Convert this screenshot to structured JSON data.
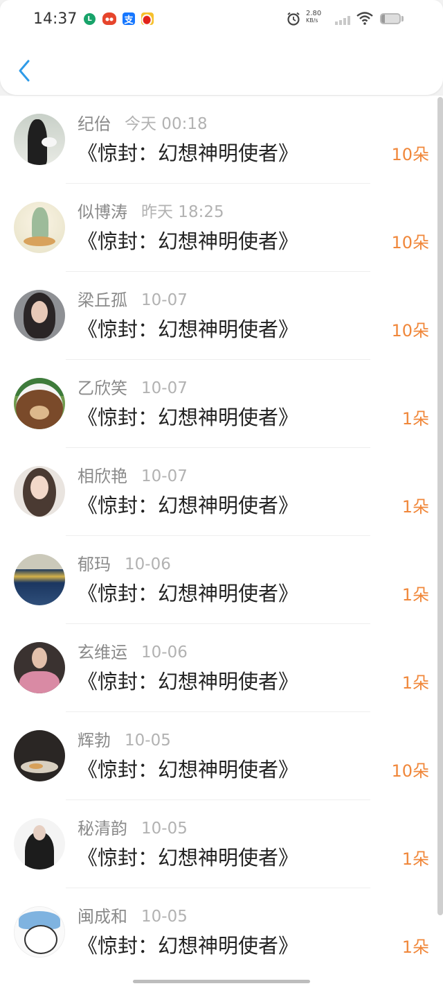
{
  "status_bar": {
    "time": "14:37",
    "l_app_glyph": "L",
    "alipay_glyph": "支",
    "net_speed_value": "2.80",
    "net_speed_unit": "KB/s",
    "battery_level": 0.2,
    "icons": [
      "l-app-icon",
      "red-app-icon",
      "alipay-icon",
      "weibo-icon",
      "alarm-icon",
      "signal-icon",
      "wifi-icon",
      "battery-icon"
    ]
  },
  "header": {
    "back_icon": "chevron-left-icon"
  },
  "colors": {
    "accent": "#2f9be8",
    "count": "#f0873a",
    "name": "#8a8a8a",
    "time": "#b2b2b2",
    "title": "#222222"
  },
  "list": {
    "items": [
      {
        "name": "纪佁",
        "time": "今天 00:18",
        "title": "《惊封：幻想神明使者》",
        "count": "10朵"
      },
      {
        "name": "似博涛",
        "time": "昨天 18:25",
        "title": "《惊封：幻想神明使者》",
        "count": "10朵"
      },
      {
        "name": "梁丘孤",
        "time": "10-07",
        "title": "《惊封：幻想神明使者》",
        "count": "10朵"
      },
      {
        "name": "乙欣笑",
        "time": "10-07",
        "title": "《惊封：幻想神明使者》",
        "count": "1朵"
      },
      {
        "name": "相欣艳",
        "time": "10-07",
        "title": "《惊封：幻想神明使者》",
        "count": "1朵"
      },
      {
        "name": "郁玛",
        "time": "10-06",
        "title": "《惊封：幻想神明使者》",
        "count": "1朵"
      },
      {
        "name": "玄维运",
        "time": "10-06",
        "title": "《惊封：幻想神明使者》",
        "count": "1朵"
      },
      {
        "name": "辉勃",
        "time": "10-05",
        "title": "《惊封：幻想神明使者》",
        "count": "10朵"
      },
      {
        "name": "秘清韵",
        "time": "10-05",
        "title": "《惊封：幻想神明使者》",
        "count": "1朵"
      },
      {
        "name": "闽成和",
        "time": "10-05",
        "title": "《惊封：幻想神明使者》",
        "count": "1朵"
      }
    ]
  }
}
